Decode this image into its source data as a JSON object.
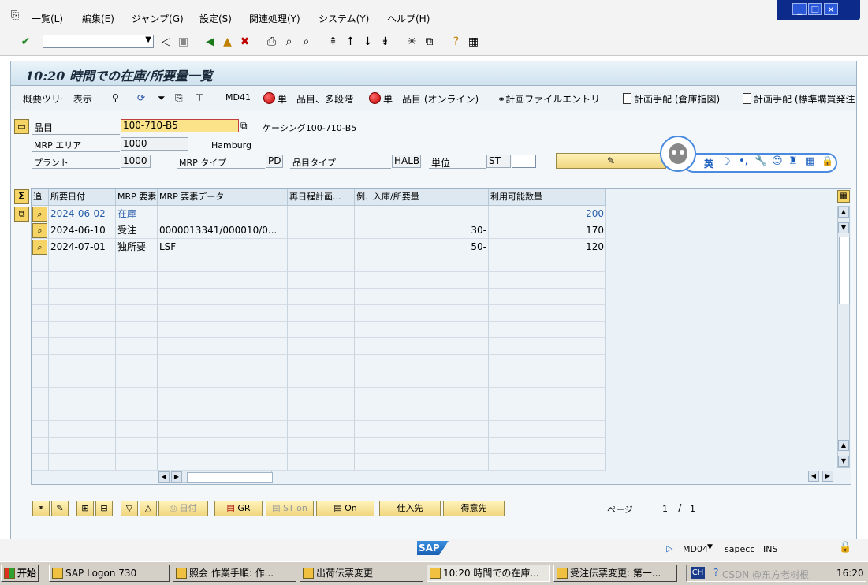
{
  "menu": {
    "items": [
      "一覧(L)",
      "編集(E)",
      "ジャンプ(G)",
      "設定(S)",
      "関連処理(Y)",
      "システム(Y)",
      "ヘルプ(H)"
    ]
  },
  "window": {
    "title": "10:20 時間での在庫/所要量一覧"
  },
  "app_toolbar": {
    "tree": "概要ツリー 表示",
    "md41": "MD41",
    "single_multi": "単一品目、多段階",
    "single_online": "単一品目 (オンライン)",
    "plan_file": "計画ファイルエントリ",
    "plan_order_storage": "計画手配 (倉庫指図)",
    "plan_order_std": "計画手配 (標準購買発注"
  },
  "header": {
    "material_label": "品目",
    "material_value": "100-710-B5",
    "material_desc": "ケーシング100-710-B5",
    "mrp_area_label": "MRP エリア",
    "mrp_area_value": "1000",
    "mrp_area_name": "Hamburg",
    "plant_label": "プラント",
    "plant_value": "1000",
    "mrp_type_label": "MRP タイプ",
    "mrp_type_value": "PD",
    "mat_type_label": "品目タイプ",
    "mat_type_value": "HALB",
    "unit_label": "単位",
    "unit_value": "ST"
  },
  "ime": {
    "lang": "英"
  },
  "table": {
    "headers": [
      "追",
      "所要日付",
      "MRP 要素",
      "MRP 要素データ",
      "再日程計画...",
      "例.",
      "入庫/所要量",
      "利用可能数量"
    ],
    "rows": [
      {
        "date": "2024-06-02",
        "elem": "在庫",
        "data": "",
        "resched": "",
        "exc": "",
        "qty": "",
        "avail": "200"
      },
      {
        "date": "2024-06-10",
        "elem": "受注",
        "data": "0000013341/000010/0...",
        "resched": "",
        "exc": "",
        "qty": "30-",
        "avail": "170"
      },
      {
        "date": "2024-07-01",
        "elem": "独所要",
        "data": "LSF",
        "resched": "",
        "exc": "",
        "qty": "50-",
        "avail": "120"
      }
    ]
  },
  "bottom": {
    "date_btn": "日付",
    "gr_btn": "GR",
    "st_btn": "ST on",
    "on_btn": "On",
    "vendor_btn": "仕入先",
    "customer_btn": "得意先",
    "page_label": "ページ",
    "page_current": "1",
    "page_sep": "/",
    "page_total": "1"
  },
  "status": {
    "sap_logo": "SAP",
    "tcode": "MD04",
    "server": "sapecc",
    "mode": "INS"
  },
  "taskbar": {
    "start": "开始",
    "tasks": [
      "SAP Logon 730",
      "照会 作業手順: 作...",
      "出荷伝票変更",
      "10:20 時間での在庫...",
      "受注伝票変更: 第一..."
    ],
    "lang": "CH",
    "watermark": "CSDN @东方老树根",
    "clock": "16:20"
  },
  "colors": {
    "accent": "#2a5da8",
    "key_field": "#fbe38a",
    "button": "#f0d680"
  }
}
